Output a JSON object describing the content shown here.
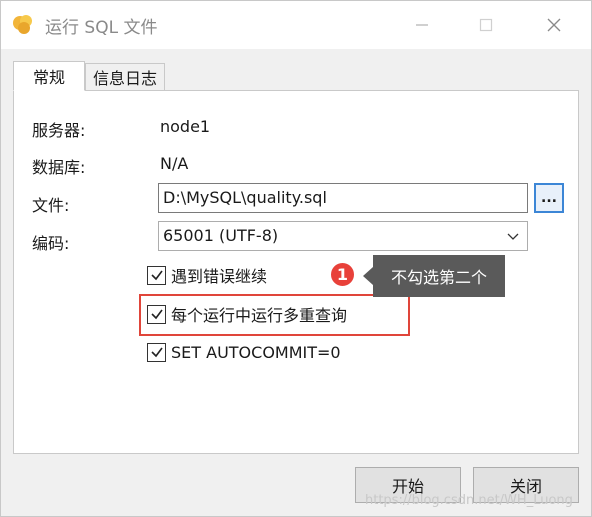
{
  "window": {
    "title": "运行 SQL 文件",
    "icon": "leaf-logo-icon",
    "controls": {
      "minimize": "minimize-icon",
      "maximize": "maximize-icon",
      "close": "close-icon"
    }
  },
  "tabs": [
    {
      "label": "常规",
      "active": true
    },
    {
      "label": "信息日志",
      "active": false
    }
  ],
  "form": {
    "server_label": "服务器:",
    "server_value": "node1",
    "database_label": "数据库:",
    "database_value": "N/A",
    "file_label": "文件:",
    "file_value": "D:\\MySQL\\quality.sql",
    "browse_label": "...",
    "encoding_label": "编码:",
    "encoding_value": "65001 (UTF-8)"
  },
  "options": [
    {
      "label": "遇到错误继续",
      "checked": true
    },
    {
      "label": "每个运行中运行多重查询",
      "checked": true
    },
    {
      "label": "SET AUTOCOMMIT=0",
      "checked": true
    }
  ],
  "annotation": {
    "badge": "1",
    "tooltip": "不勾选第二个",
    "highlight_color": "#e0453a",
    "badge_color": "#e8413a"
  },
  "buttons": {
    "start": "开始",
    "close": "关闭"
  },
  "watermark": "https://blog.csdn.net/WH_Luong",
  "colors": {
    "accent": "#3c86d6",
    "window_bg": "#f0f0f0"
  }
}
